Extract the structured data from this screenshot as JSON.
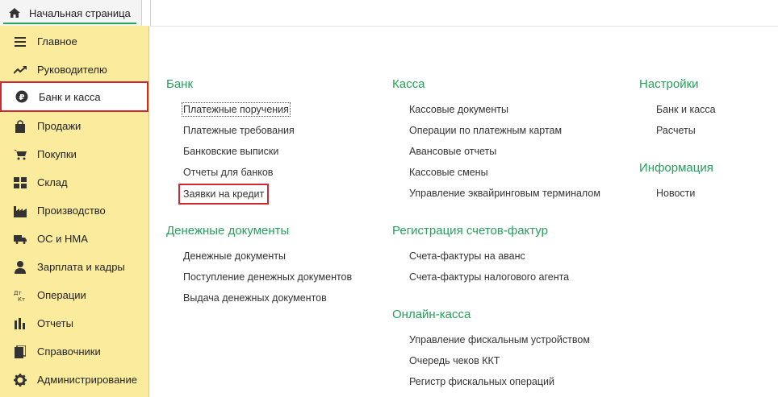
{
  "tab": {
    "label": "Начальная страница"
  },
  "sidebar": {
    "items": [
      {
        "label": "Главное",
        "icon": "menu-lines-icon"
      },
      {
        "label": "Руководителю",
        "icon": "trend-icon"
      },
      {
        "label": "Банк и касса",
        "icon": "ruble-coin-icon"
      },
      {
        "label": "Продажи",
        "icon": "shopping-bag-icon"
      },
      {
        "label": "Покупки",
        "icon": "cart-icon"
      },
      {
        "label": "Склад",
        "icon": "warehouse-grid-icon"
      },
      {
        "label": "Производство",
        "icon": "factory-icon"
      },
      {
        "label": "ОС и НМА",
        "icon": "truck-icon"
      },
      {
        "label": "Зарплата и кадры",
        "icon": "person-icon"
      },
      {
        "label": "Операции",
        "icon": "dt-kt-icon"
      },
      {
        "label": "Отчеты",
        "icon": "bar-chart-icon"
      },
      {
        "label": "Справочники",
        "icon": "books-icon"
      },
      {
        "label": "Администрирование",
        "icon": "gear-icon"
      }
    ],
    "active_index": 2,
    "dt_label": "Дт",
    "kt_label": "Кт"
  },
  "sections": {
    "bank": {
      "title": "Банк",
      "links": [
        "Платежные поручения",
        "Платежные требования",
        "Банковские выписки",
        "Отчеты для банков",
        "Заявки на кредит"
      ]
    },
    "money_docs": {
      "title": "Денежные документы",
      "links": [
        "Денежные документы",
        "Поступление денежных документов",
        "Выдача денежных документов"
      ]
    },
    "kassa": {
      "title": "Касса",
      "links": [
        "Кассовые документы",
        "Операции по платежным картам",
        "Авансовые отчеты",
        "Кассовые смены",
        "Управление эквайринговым терминалом"
      ]
    },
    "invoices": {
      "title": "Регистрация счетов-фактур",
      "links": [
        "Счета-фактуры на аванс",
        "Счета-фактуры налогового агента"
      ]
    },
    "online_kassa": {
      "title": "Онлайн-касса",
      "links": [
        "Управление фискальным устройством",
        "Очередь чеков ККТ",
        "Регистр фискальных операций"
      ]
    },
    "settings": {
      "title": "Настройки",
      "links": [
        "Банк и касса",
        "Расчеты"
      ]
    },
    "info": {
      "title": "Информация",
      "links": [
        "Новости"
      ]
    }
  },
  "colors": {
    "accent": "#26a05a",
    "highlight": "#d22630",
    "sidebar": "#fbeb9c"
  }
}
